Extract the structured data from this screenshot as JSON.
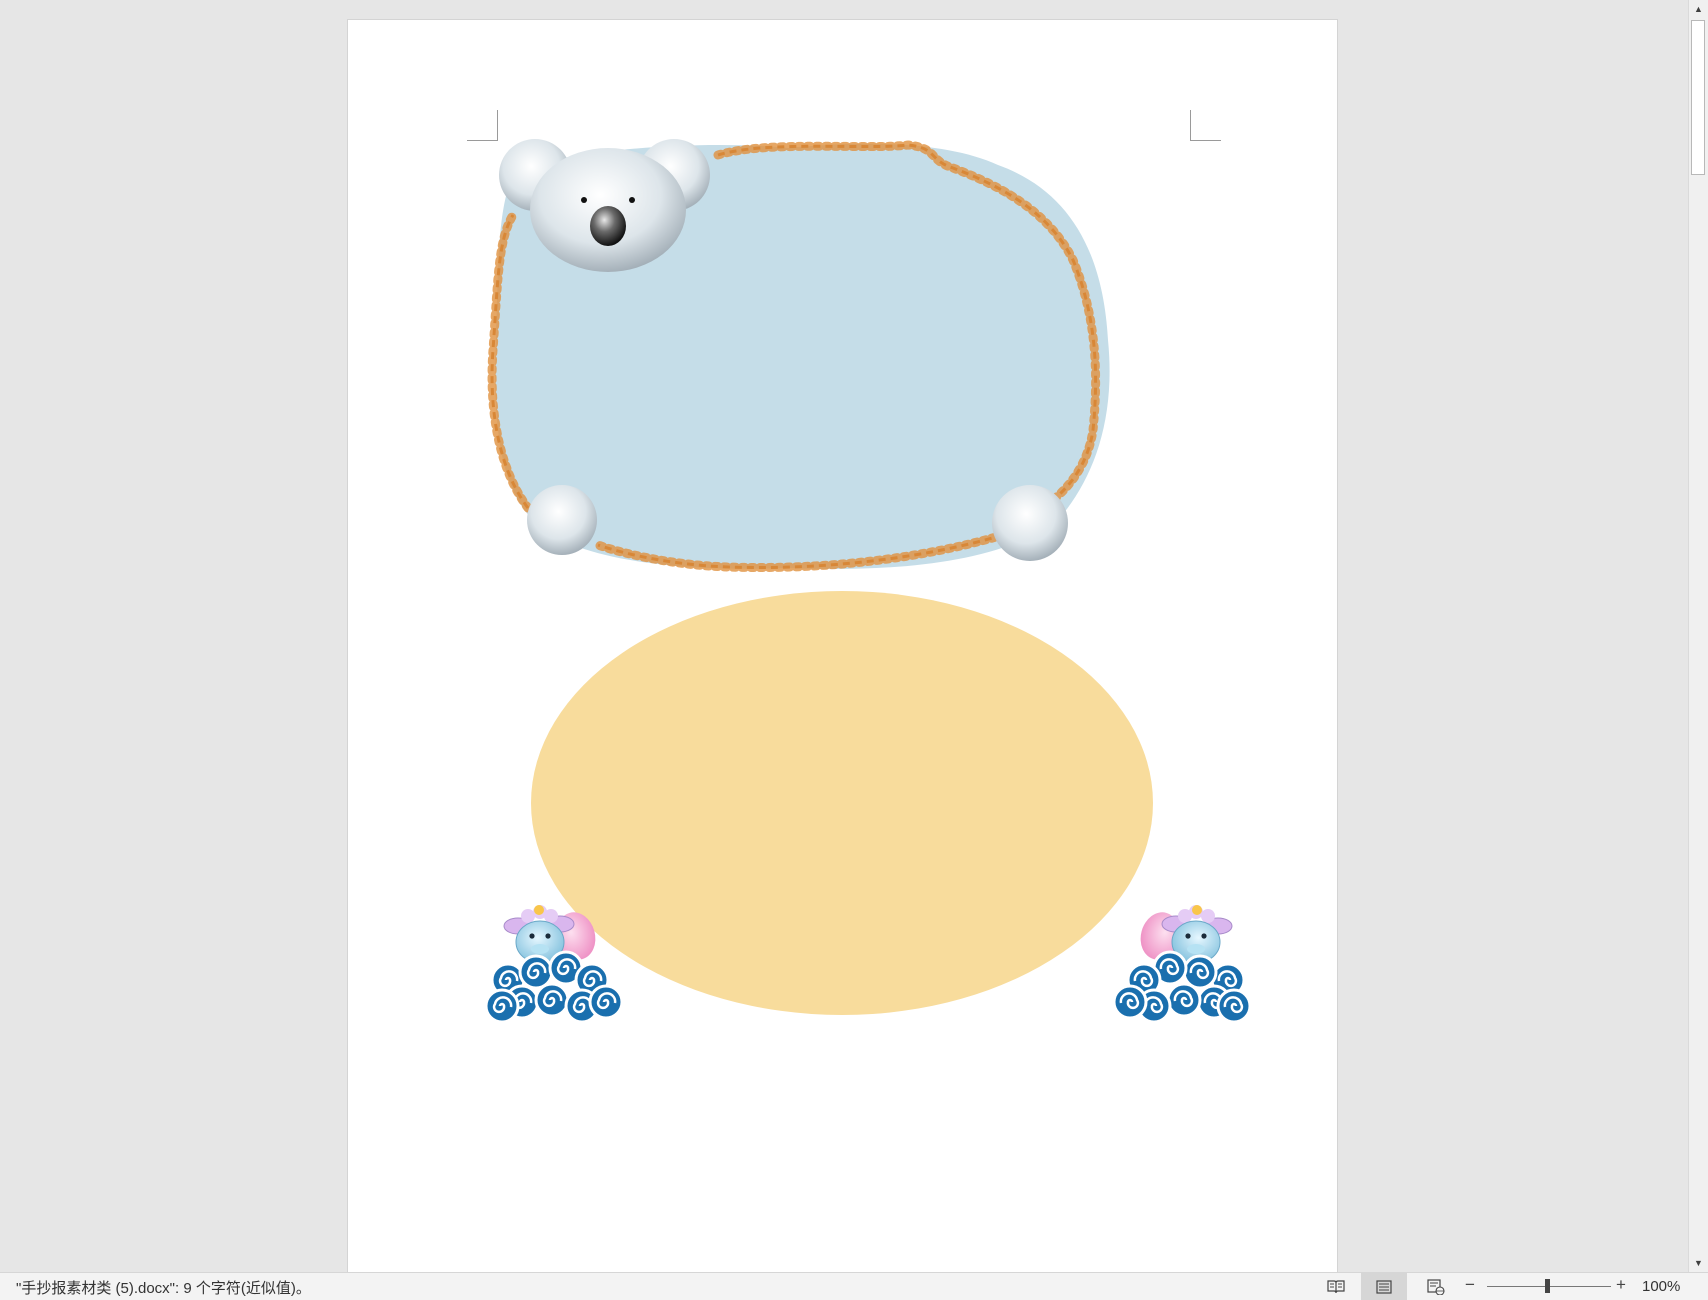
{
  "status_bar": {
    "document_info": "\"手抄报素材类 (5).docx\": 9 个字符(近似值)。",
    "zoom_minus": "−",
    "zoom_plus": "+",
    "zoom_level": "100%"
  },
  "scrollbar": {
    "up_arrow": "▲",
    "down_arrow": "▼"
  },
  "document": {
    "content": [
      {
        "type": "koala-frame",
        "fill": "#c5dde8",
        "border_color": "#b8621c"
      },
      {
        "type": "oval-frame",
        "fill": "#f8dc9c"
      },
      {
        "type": "sheep-on-clouds",
        "side": "left"
      },
      {
        "type": "sheep-on-clouds",
        "side": "right"
      }
    ]
  },
  "colors": {
    "workspace": "#e6e6e6",
    "page": "#ffffff",
    "frame_fill": "#c5dde8",
    "leaf_vine": "#b8621c",
    "oval_fill": "#f8dc9c",
    "koala_fur": "#d8e1e6",
    "cloud_blue": "#1a6fae",
    "sheep_ear": "#f2a8d0"
  },
  "icons": [
    "read-mode-icon",
    "print-layout-icon",
    "web-layout-icon"
  ]
}
